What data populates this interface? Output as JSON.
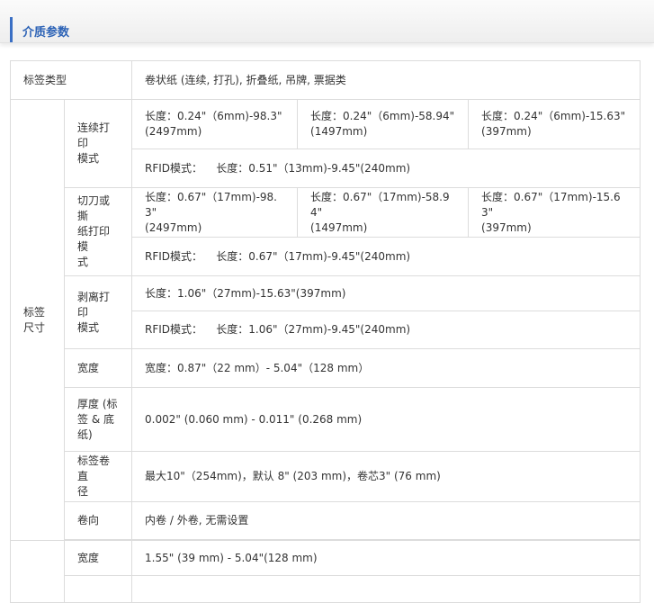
{
  "section": {
    "title": "介质参数"
  },
  "rows": {
    "label_type": {
      "name": "标签类型",
      "value": "卷状纸 (连续, 打孔), 折叠纸, 吊牌, 票据类"
    },
    "label_size": {
      "name": "标签\n尺寸",
      "continuous": {
        "name": "连续打印\n模式",
        "values": [
          "长度：0.24\"（6mm)-98.3\"\n(2497mm)",
          "长度：0.24\"（6mm)-58.94\"\n(1497mm)",
          "长度：0.24\"（6mm)-15.63\"\n(397mm)"
        ],
        "rfid": "RFID模式：    长度：0.51\"（13mm)-9.45\"(240mm)"
      },
      "cutter": {
        "name": "切刀或撕\n纸打印模\n式",
        "values": [
          "长度：0.67\"（17mm)-98.3\"\n(2497mm)",
          "长度：0.67\"（17mm)-58.94\"\n(1497mm)",
          "长度：0.67\"（17mm)-15.63\"\n(397mm)"
        ],
        "rfid": "RFID模式：    长度：0.67\"（17mm)-9.45\"(240mm)"
      },
      "peel": {
        "name": "剥离打印\n模式",
        "value": "长度：1.06\"（27mm)-15.63\"(397mm)",
        "rfid": "RFID模式：    长度：1.06\"（27mm)-9.45\"(240mm)"
      },
      "width": {
        "name": "宽度",
        "value": "宽度：0.87\"（22 mm）- 5.04\"（128 mm）"
      },
      "thickness": {
        "name": "厚度 (标\n签 & 底\n纸)",
        "value": "0.002\" (0.060 mm) - 0.011\" (0.268 mm)"
      },
      "roll_diameter": {
        "name": "标签卷直\n径",
        "value": "最大10\"（254mm)，默认 8\" (203 mm)，卷芯3\" (76 mm)"
      },
      "winding": {
        "name": "卷向",
        "value": "内卷 / 外卷, 无需设置"
      }
    },
    "next_group": {
      "name": "",
      "width": {
        "name": "宽度",
        "value": "1.55\" (39 mm) - 5.04\"(128 mm)"
      }
    }
  }
}
